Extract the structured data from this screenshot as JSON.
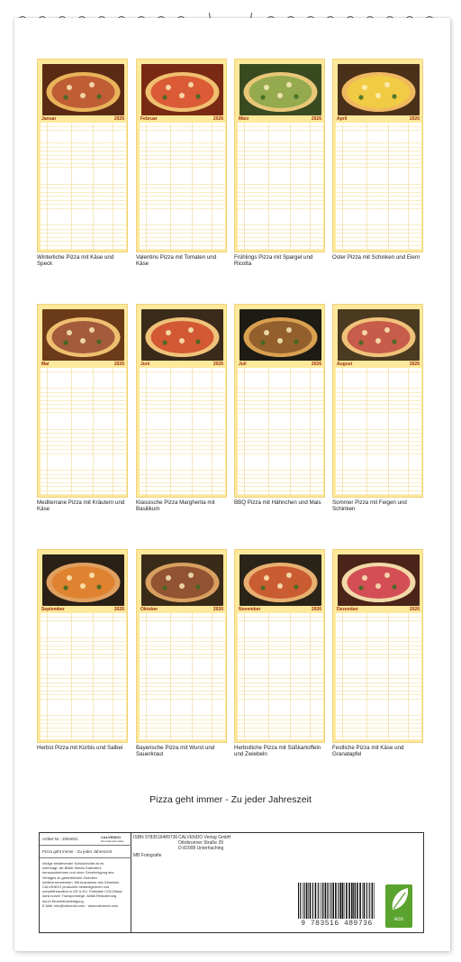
{
  "title": "Pizza geht immer - Zu jeder Jahreszeit",
  "colors": {
    "page_bg": "#fde99b",
    "accent": "#9b2c10",
    "eco_green": "#5aa32e"
  },
  "months": [
    {
      "name": "Januar",
      "year": "2026",
      "caption": "Winterliche Pizza mit Käse und Speck"
    },
    {
      "name": "Februar",
      "year": "2026",
      "caption": "Valentins Pizza mit Tomaten und Käse"
    },
    {
      "name": "März",
      "year": "2026",
      "caption": "Frühlings Pizza mit Spargel und Ricotta"
    },
    {
      "name": "April",
      "year": "2026",
      "caption": "Oster Pizza mit Schinken und Eiern"
    },
    {
      "name": "Mai",
      "year": "2026",
      "caption": "Mediterrane Pizza mit Kräutern und Käse"
    },
    {
      "name": "Juni",
      "year": "2026",
      "caption": "Klassische Pizza Margherita mit Basilikum"
    },
    {
      "name": "Juli",
      "year": "2026",
      "caption": "BBQ Pizza mit Hähnchen und Mais"
    },
    {
      "name": "August",
      "year": "2026",
      "caption": "Sommer Pizza mit Feigen und Schinken"
    },
    {
      "name": "September",
      "year": "2026",
      "caption": "Herbst Pizza mit Kürbis und Salbei"
    },
    {
      "name": "Oktober",
      "year": "2026",
      "caption": "Bayerische Pizza mit Wurst und Sauerkraut"
    },
    {
      "name": "November",
      "year": "2026",
      "caption": "Herbstliche Pizza mit Süßkartoffeln und Zwiebeln"
    },
    {
      "name": "Dezember",
      "year": "2026",
      "caption": "Festliche Pizza mit Käse und Granatapfel"
    }
  ],
  "meta": {
    "article_label": "Artikel Nr.: 2084001",
    "logo_text": "CALVENDO",
    "logo_sub": "Die Kalendermarke",
    "product_line": "Pizza geht immer - Zu jeder Jahreszeit",
    "isbn": "ISBN 9783516489736",
    "publisher_1": "CALVENDO Verlag GmbH",
    "publisher_2": "Ottobrunner Straße 39",
    "publisher_3": "D-82008 Unterhaching",
    "photographer": "MB Fotografie",
    "legal_1": "Infolge bestehender Schutzrechte ist es",
    "legal_2": "untersagt, die Bilder dieses Kalenders",
    "legal_3": "herauszutrennen und ohne Genehmigung des",
    "legal_4": "Verlages zu gewerblichen Zwecken",
    "legal_5": "weiterzuverwenden. Mit Ausnahme des Gesetzes",
    "legal_6": "CALVENDO produziert bedarfsgerecht und",
    "legal_7": "umweltfreundlich in DE & EU. Preisliste CO2-Bilanz",
    "legal_8": "dank kurzer Transportwege. Abfall-Reduzierung",
    "legal_9": "durch Einzelstückfertigung.",
    "legal_10": "E-Mail: info@calvendo.com · www.calvendo.com",
    "barcode_number": "9 783516 489736",
    "eco_label": "eco"
  }
}
